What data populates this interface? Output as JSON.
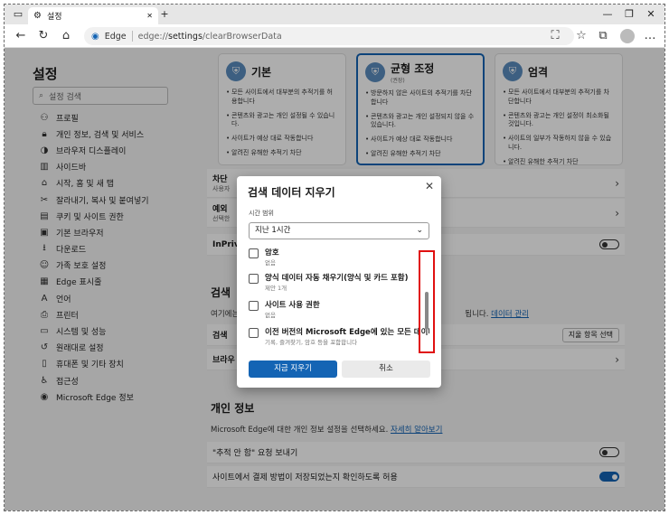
{
  "browser": {
    "tab_title": "설정",
    "site_label": "Edge",
    "url_prefix": "edge://",
    "url_bold": "settings",
    "url_rest": "/clearBrowserData",
    "new_tab": "+",
    "tab_close": "✕"
  },
  "sidebar": {
    "title": "설정",
    "search_placeholder": "설정 검색",
    "items": [
      {
        "label": "프로필",
        "icon": "profile-icon"
      },
      {
        "label": "개인 정보, 검색 및 서비스",
        "icon": "lock-icon"
      },
      {
        "label": "브라우저 디스플레이",
        "icon": "display-icon"
      },
      {
        "label": "사이드바",
        "icon": "sidebar-icon"
      },
      {
        "label": "시작, 홈 및 새 탭",
        "icon": "home-icon"
      },
      {
        "label": "잘라내기, 복사 및 붙여넣기",
        "icon": "clipboard-icon"
      },
      {
        "label": "쿠키 및 사이트 권한",
        "icon": "cookie-icon"
      },
      {
        "label": "기본 브라우저",
        "icon": "browser-icon"
      },
      {
        "label": "다운로드",
        "icon": "download-icon"
      },
      {
        "label": "가족 보호 설정",
        "icon": "family-icon"
      },
      {
        "label": "Edge 표시줄",
        "icon": "edge-bar-icon"
      },
      {
        "label": "언어",
        "icon": "language-icon"
      },
      {
        "label": "프린터",
        "icon": "printer-icon"
      },
      {
        "label": "시스템 및 성능",
        "icon": "system-icon"
      },
      {
        "label": "원래대로 설정",
        "icon": "reset-icon"
      },
      {
        "label": "휴대폰 및 기타 장치",
        "icon": "phone-icon"
      },
      {
        "label": "접근성",
        "icon": "accessibility-icon"
      },
      {
        "label": "Microsoft Edge 정보",
        "icon": "edge-logo-icon"
      }
    ]
  },
  "cards": [
    {
      "title": "기본",
      "subtitle": "",
      "bullets": [
        "모든 사이트에서 대부분의 추적기를 허용합니다",
        "콘텐츠와 광고는 개인 설정될 수 있습니다.",
        "사이트가 예상 대로 작동합니다",
        "알려진 유해한 추적기 차단"
      ]
    },
    {
      "title": "균형 조정",
      "subtitle": "(권장)",
      "bullets": [
        "방문하지 않은 사이트의 추적기를 차단합니다",
        "콘텐츠와 광고는 개인 설정되지 않을 수 있습니다.",
        "사이트가 예상 대로 작동합니다",
        "알려진 유해한 추적기 차단"
      ]
    },
    {
      "title": "엄격",
      "subtitle": "",
      "bullets": [
        "모든 사이트에서 대부분의 추적기를 차단합니다",
        "콘텐츠와 광고는 개인 설정이 최소화될 것입니다.",
        "사이트의 일부가 작동하지 않을 수 있습니다.",
        "알려진 유해한 추적기 차단"
      ]
    }
  ],
  "rows": {
    "block_title": "차단",
    "block_desc": "사용자",
    "exception_title": "예외",
    "exception_desc": "선택한",
    "inprivate_title": "InPriv",
    "clear_section": "검색",
    "clear_desc_prefix": "여기에는",
    "clear_desc_suffix": "됩니다.",
    "data_manage_link": "데이터 관리",
    "clear_now_row": "검색",
    "choose_button": "지울 항목 선택",
    "browser_row": "브라우"
  },
  "privacy": {
    "title": "개인 정보",
    "desc": "Microsoft Edge에 대한 개인 정보 설정을 선택하세요.",
    "learn_more": "자세히 알아보기",
    "dnt": "\"추적 안 함\" 요청 보내기",
    "payment": "사이트에서 결제 방법이 저장되었는지 확인하도록 허용"
  },
  "dialog": {
    "title": "검색 데이터 지우기",
    "time_label": "시간 범위",
    "time_value": "지난 1시간",
    "items": [
      {
        "title": "암호",
        "sub": "없음"
      },
      {
        "title": "양식 데이터 자동 채우기(양식 및 카드 포함)",
        "sub": "제안 1개"
      },
      {
        "title": "사이트 사용 권한",
        "sub": "없음"
      },
      {
        "title": "이전 버전의 Microsoft Edge에 있는 모든 데이터",
        "sub": "기록, 즐겨찾기, 암호 등을 포함합니다"
      }
    ],
    "clear_button": "지금 지우기",
    "cancel_button": "취소"
  }
}
